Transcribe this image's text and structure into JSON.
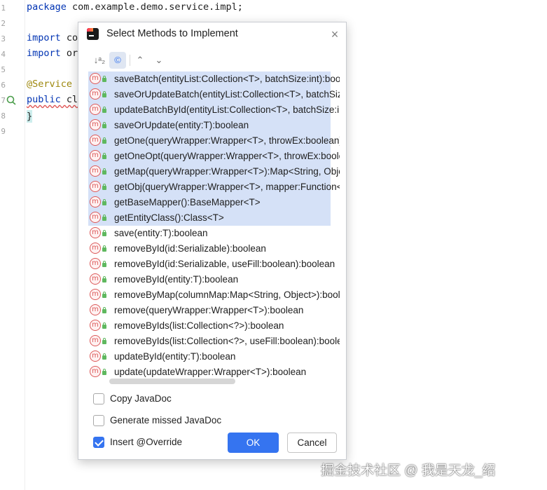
{
  "editor": {
    "line_numbers": [
      "1",
      "2",
      "3",
      "4",
      "5",
      "6",
      "7",
      "8",
      "9"
    ],
    "lines": [
      {
        "parts": [
          {
            "t": "package",
            "c": "kw"
          },
          {
            "t": " com.example.demo.service.impl;",
            "c": ""
          }
        ]
      },
      {
        "parts": []
      },
      {
        "parts": [
          {
            "t": "import",
            "c": "kw"
          },
          {
            "t": " co",
            "c": ""
          }
        ]
      },
      {
        "parts": [
          {
            "t": "import",
            "c": "kw"
          },
          {
            "t": " or",
            "c": ""
          }
        ]
      },
      {
        "parts": []
      },
      {
        "parts": [
          {
            "t": "@Service",
            "c": "ann"
          }
        ]
      },
      {
        "parts": [
          {
            "t": "public",
            "c": "kw"
          },
          {
            "t": " cl",
            "c": ""
          }
        ]
      },
      {
        "parts": []
      },
      {
        "parts": []
      }
    ],
    "closing_brace": "}"
  },
  "dialog": {
    "title": "Select Methods to Implement",
    "close_glyph": "×",
    "toolbar": {
      "sort_alpha": "↓ᵃ₂",
      "show_classes": "©",
      "expand_all": "⌃",
      "collapse_all": "⌄"
    },
    "method_icon_letter": "m",
    "methods": [
      {
        "label": "saveBatch(entityList:Collection<T>, batchSize:int):boolean",
        "selected": true
      },
      {
        "label": "saveOrUpdateBatch(entityList:Collection<T>, batchSize:int):boolean",
        "selected": true
      },
      {
        "label": "updateBatchById(entityList:Collection<T>, batchSize:int):boolean",
        "selected": true
      },
      {
        "label": "saveOrUpdate(entity:T):boolean",
        "selected": true
      },
      {
        "label": "getOne(queryWrapper:Wrapper<T>, throwEx:boolean):T",
        "selected": true
      },
      {
        "label": "getOneOpt(queryWrapper:Wrapper<T>, throwEx:boolean):Optional<T>",
        "selected": true
      },
      {
        "label": "getMap(queryWrapper:Wrapper<T>):Map<String, Object>",
        "selected": true
      },
      {
        "label": "getObj(queryWrapper:Wrapper<T>, mapper:Function<? super Object, V>):V",
        "selected": true
      },
      {
        "label": "getBaseMapper():BaseMapper<T>",
        "selected": true
      },
      {
        "label": "getEntityClass():Class<T>",
        "selected": true
      },
      {
        "label": "save(entity:T):boolean",
        "selected": false
      },
      {
        "label": "removeById(id:Serializable):boolean",
        "selected": false
      },
      {
        "label": "removeById(id:Serializable, useFill:boolean):boolean",
        "selected": false
      },
      {
        "label": "removeById(entity:T):boolean",
        "selected": false
      },
      {
        "label": "removeByMap(columnMap:Map<String, Object>):boolean",
        "selected": false
      },
      {
        "label": "remove(queryWrapper:Wrapper<T>):boolean",
        "selected": false
      },
      {
        "label": "removeByIds(list:Collection<?>):boolean",
        "selected": false
      },
      {
        "label": "removeByIds(list:Collection<?>, useFill:boolean):boolean",
        "selected": false
      },
      {
        "label": "updateById(entity:T):boolean",
        "selected": false
      },
      {
        "label": "update(updateWrapper:Wrapper<T>):boolean",
        "selected": false
      }
    ],
    "options": [
      {
        "label": "Copy JavaDoc",
        "checked": false
      },
      {
        "label": "Generate missed JavaDoc",
        "checked": false
      },
      {
        "label": "Insert @Override",
        "checked": true
      }
    ],
    "ok_label": "OK",
    "cancel_label": "Cancel"
  },
  "watermark": "掘金技术社区 @ 我是天龙_绍",
  "colors": {
    "selection": "#d5e1f7",
    "accent": "#3574f0",
    "method_icon": "#dc5a5a"
  }
}
